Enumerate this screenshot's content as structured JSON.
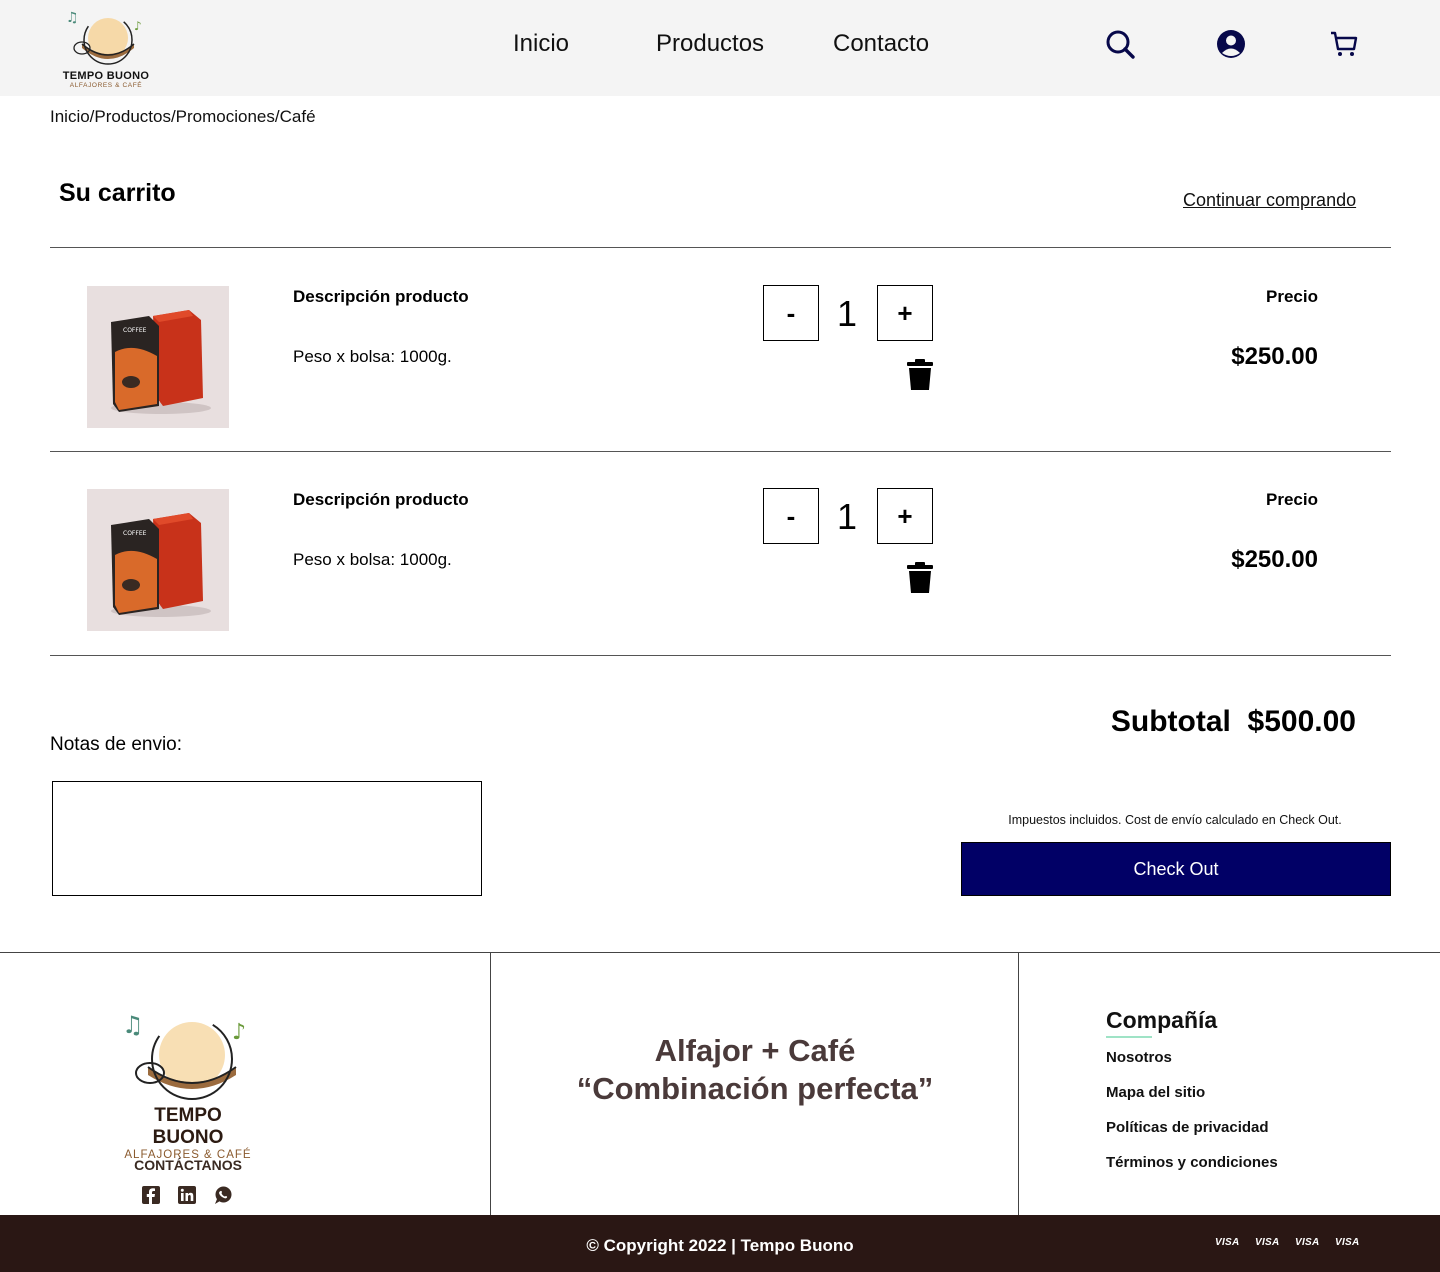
{
  "header": {
    "brand": "TEMPO BUONO",
    "brand_sub": "ALFAJORES & CAFÉ",
    "nav": [
      "Inicio",
      "Productos",
      "Contacto"
    ],
    "icons": [
      "search-icon",
      "user-icon",
      "cart-icon"
    ]
  },
  "breadcrumb": "Inicio/Productos/Promociones/Café",
  "cart": {
    "title": "Su carrito",
    "continue_label": "Continuar comprando",
    "items": [
      {
        "description": "Descripción producto",
        "weight": "Peso x bolsa: 1000g.",
        "quantity": "1",
        "price_label": "Precio",
        "price": "$250.00",
        "minus": "-",
        "plus": "+"
      },
      {
        "description": "Descripción producto",
        "weight": "Peso x bolsa: 1000g.",
        "quantity": "1",
        "price_label": "Precio",
        "price": "$250.00",
        "minus": "-",
        "plus": "+"
      }
    ],
    "notes_label": "Notas de envio:",
    "notes_value": "",
    "subtotal": "Subtotal  $500.00",
    "tax_note": "Impuestos incluidos. Cost de envío calculado en Check Out.",
    "checkout_label": "Check Out"
  },
  "footer": {
    "brand": "TEMPO BUONO",
    "brand_sub": "ALFAJORES & CAFÉ",
    "contact_label": "CONTÁCTANOS",
    "social_icons": [
      "facebook-icon",
      "linkedin-icon",
      "whatsapp-icon"
    ],
    "slogan_line1": "Alfajor + Café",
    "slogan_line2": "“Combinación perfecta”",
    "company_title": "Compañía",
    "company_links": [
      "Nosotros",
      "Mapa del sitio",
      "Políticas de privacidad",
      "Términos y condiciones"
    ],
    "copyright": "© Copyright 2022 | Tempo Buono",
    "payment_icons": [
      "VISA",
      "VISA",
      "VISA",
      "VISA"
    ]
  },
  "colors": {
    "header_bg": "#f4f4f4",
    "checkout_bg": "#010066",
    "footer_bar_bg": "#2a1714",
    "accent_brown": "#8a5a2e"
  }
}
